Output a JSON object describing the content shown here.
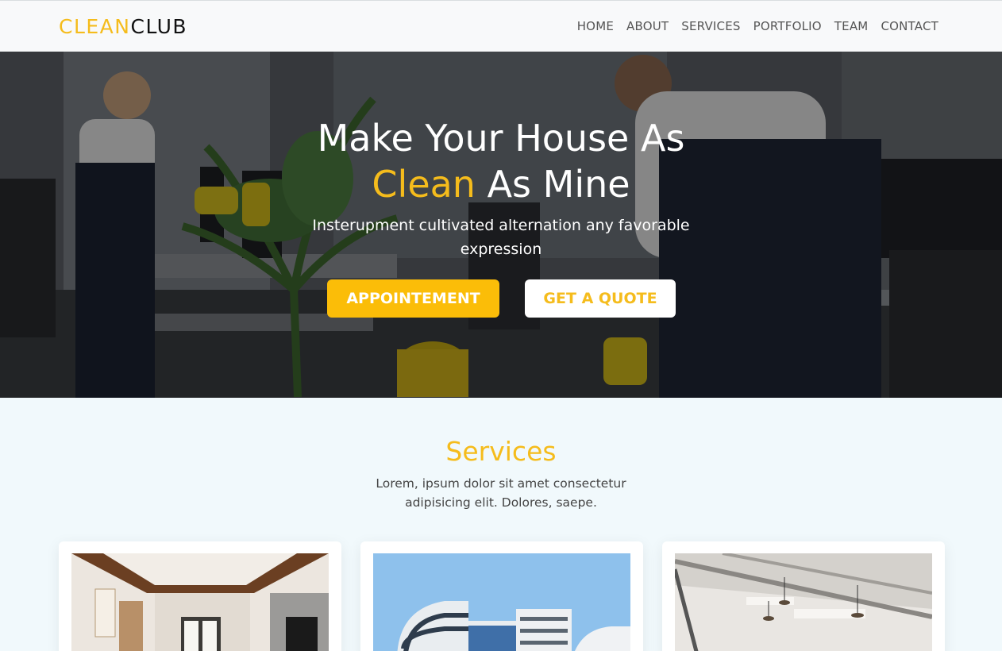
{
  "header": {
    "logo_part1": "CLEAN",
    "logo_part2": "CLUB",
    "nav": [
      "HOME",
      "ABOUT",
      "SERVICES",
      "PORTFOLIO",
      "TEAM",
      "CONTACT"
    ]
  },
  "hero": {
    "title_line1": "Make Your House As",
    "title_accent": "Clean",
    "title_rest": " As Mine",
    "subtitle": "Insterupment cultivated alternation any favorable expression",
    "primary_button": "APPOINTEMENT",
    "secondary_button": "GET A QUOTE"
  },
  "services": {
    "title": "Services",
    "description": "Lorem, ipsum dolor sit amet consectetur adipisicing elit. Dolores, saepe."
  },
  "colors": {
    "accent": "#f5bc1c",
    "button_yellow": "#fbbd08",
    "background": "#f1f9fc"
  }
}
